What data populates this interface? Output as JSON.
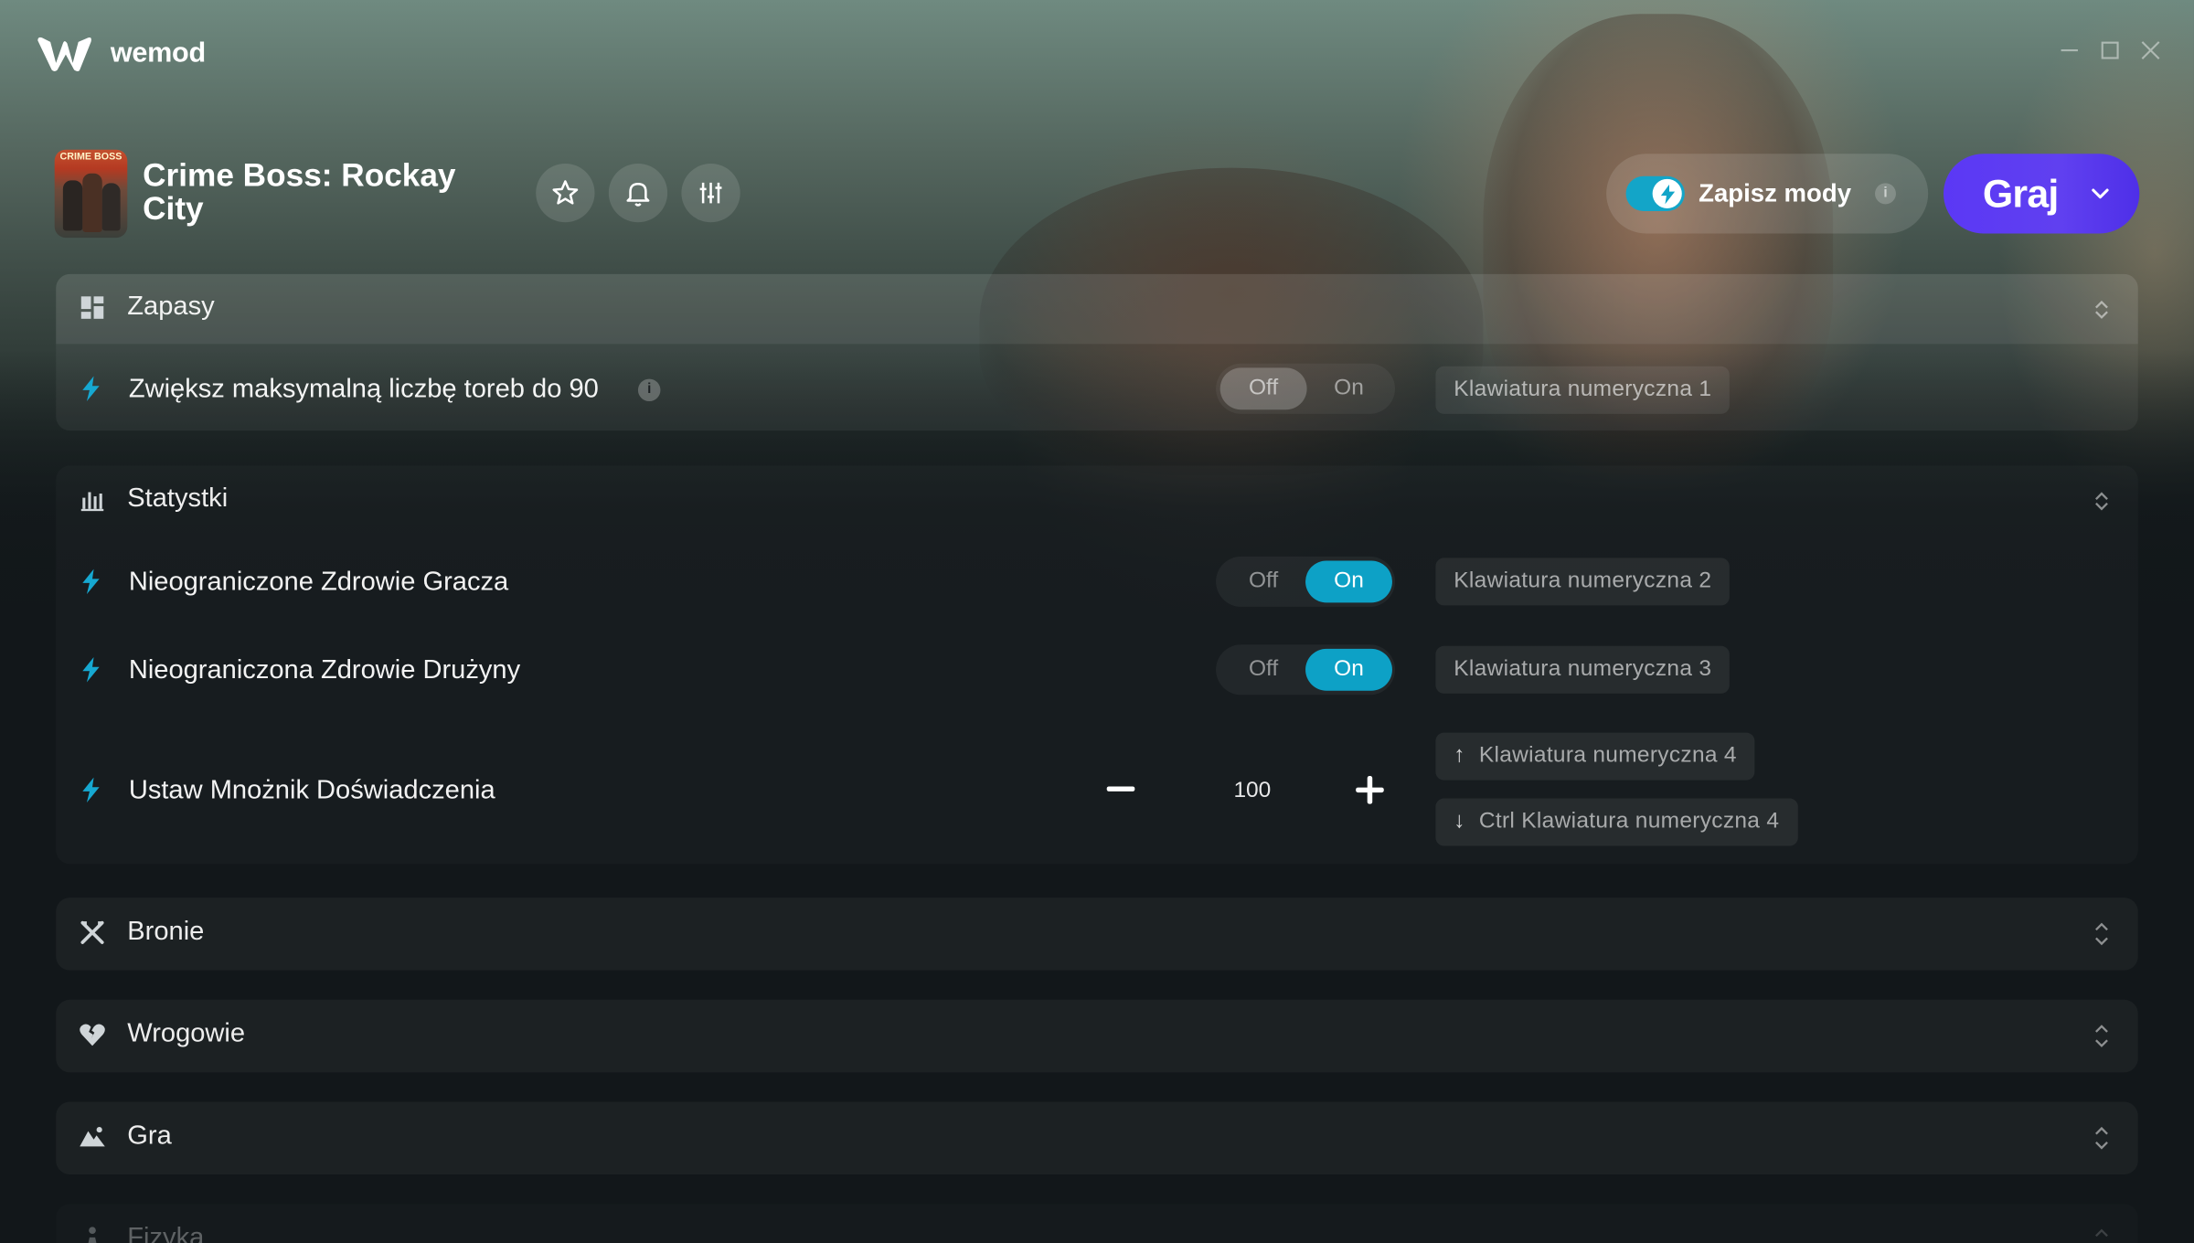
{
  "app": {
    "brand": "wemod",
    "window_controls": {
      "minimize": "minimize-icon",
      "maximize": "maximize-icon",
      "close": "close-icon"
    }
  },
  "game": {
    "title": "Crime Boss: Rockay City",
    "cover_text": "CRIME BOSS",
    "actions": [
      "star-icon",
      "bell-icon",
      "sliders-icon"
    ]
  },
  "save_mods": {
    "label": "Zapisz mody",
    "enabled": true,
    "info": "i"
  },
  "play": {
    "label": "Graj"
  },
  "colors": {
    "accent": "#0da1c6",
    "play": "#5b38f5"
  },
  "sections": [
    {
      "title": "Zapasy",
      "icon": "grid-icon",
      "expanded": true,
      "mods": [
        {
          "label": "Zwiększ maksymalną liczbę toreb do 90",
          "type": "toggle",
          "off": "Off",
          "on": "On",
          "state": "off",
          "hotkey": "Klawiatura numeryczna 1",
          "info": "i"
        }
      ]
    },
    {
      "title": "Statystki",
      "icon": "bar-chart-icon",
      "expanded": true,
      "mods": [
        {
          "label": "Nieograniczone Zdrowie Gracza",
          "type": "toggle",
          "off": "Off",
          "on": "On",
          "state": "on",
          "hotkey": "Klawiatura numeryczna 2"
        },
        {
          "label": "Nieograniczona Zdrowie Drużyny",
          "type": "toggle",
          "off": "Off",
          "on": "On",
          "state": "on",
          "hotkey": "Klawiatura numeryczna 3"
        },
        {
          "label": "Ustaw Mnożnik Doświadczenia",
          "type": "stepper",
          "value": "100",
          "hotkey_up": "Klawiatura numeryczna 4",
          "hotkey_down": "Ctrl Klawiatura numeryczna 4"
        }
      ]
    },
    {
      "title": "Bronie",
      "icon": "crossed-swords-icon",
      "expanded": false
    },
    {
      "title": "Wrogowie",
      "icon": "broken-heart-icon",
      "expanded": false
    },
    {
      "title": "Gra",
      "icon": "landscape-icon",
      "expanded": false
    },
    {
      "title": "Fizyka",
      "icon": "figure-icon",
      "expanded": false
    }
  ]
}
